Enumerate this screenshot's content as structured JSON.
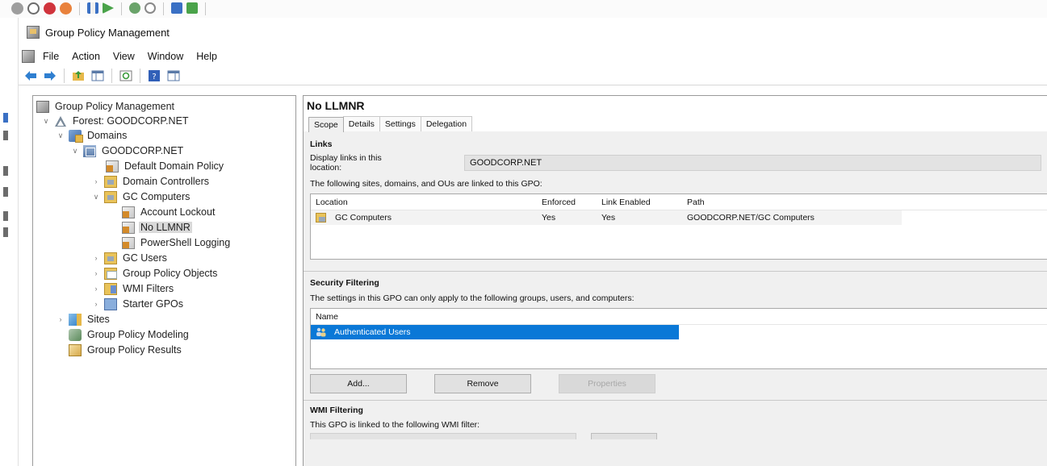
{
  "window": {
    "title": "Group Policy Management"
  },
  "menu": {
    "file": "File",
    "action": "Action",
    "view": "View",
    "window": "Window",
    "help": "Help"
  },
  "tree": {
    "root": "Group Policy Management",
    "forest": "Forest: GOODCORP.NET",
    "domains": "Domains",
    "domain": "GOODCORP.NET",
    "default_policy": "Default Domain Policy",
    "domain_controllers": "Domain Controllers",
    "gc_computers": "GC Computers",
    "account_lockout": "Account Lockout",
    "no_llmnr": "No LLMNR",
    "powershell_logging": "PowerShell Logging",
    "gc_users": "GC Users",
    "gpo_objects": "Group Policy Objects",
    "wmi_filters": "WMI Filters",
    "starter_gpos": "Starter GPOs",
    "sites": "Sites",
    "modeling": "Group Policy Modeling",
    "results": "Group Policy Results"
  },
  "details": {
    "title": "No LLMNR",
    "tabs": [
      "Scope",
      "Details",
      "Settings",
      "Delegation"
    ],
    "links_heading": "Links",
    "display_links_label": "Display links in this location:",
    "display_links_value": "GOODCORP.NET",
    "linked_text": "The following sites, domains, and OUs are linked to this GPO:",
    "links_columns": [
      "Location",
      "Enforced",
      "Link Enabled",
      "Path"
    ],
    "links_rows": [
      {
        "location": "GC Computers",
        "enforced": "Yes",
        "link_enabled": "Yes",
        "path": "GOODCORP.NET/GC Computers"
      }
    ],
    "security_heading": "Security Filtering",
    "security_text": "The settings in this GPO can only apply to the following groups, users, and computers:",
    "security_column": "Name",
    "security_rows": [
      "Authenticated Users"
    ],
    "buttons": {
      "add": "Add...",
      "remove": "Remove",
      "properties": "Properties"
    },
    "wmi_heading": "WMI Filtering",
    "wmi_text": "This GPO is linked to the following WMI filter:"
  }
}
